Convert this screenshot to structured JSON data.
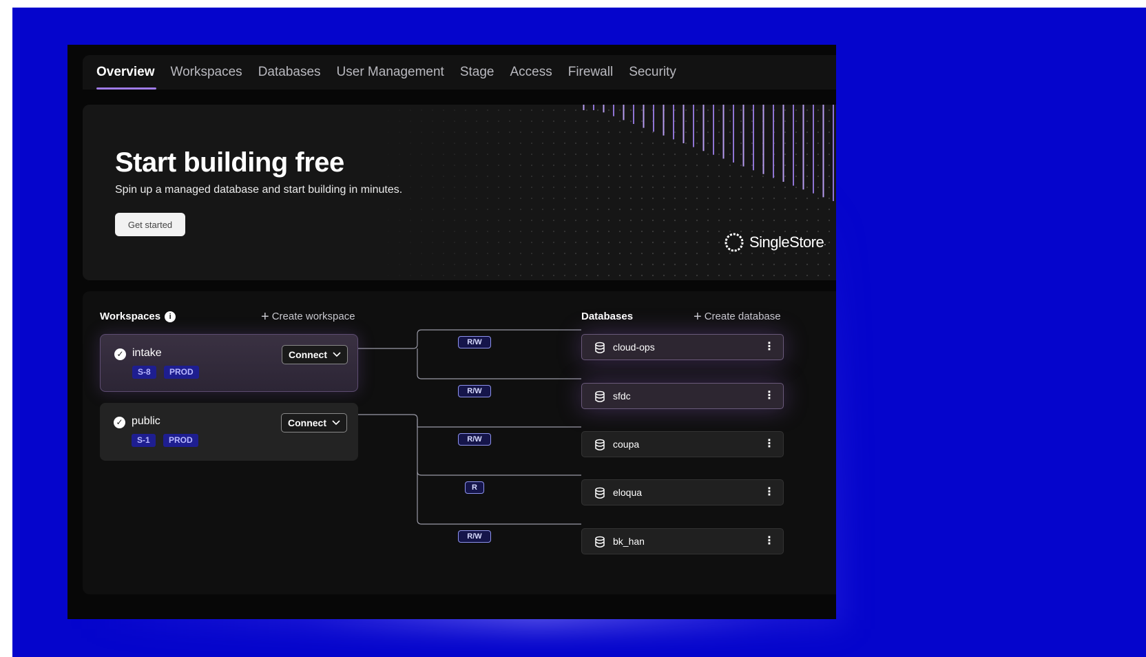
{
  "tabs": [
    {
      "label": "Overview",
      "active": true
    },
    {
      "label": "Workspaces"
    },
    {
      "label": "Databases"
    },
    {
      "label": "User Management"
    },
    {
      "label": "Stage"
    },
    {
      "label": "Access"
    },
    {
      "label": "Firewall"
    },
    {
      "label": "Security"
    }
  ],
  "hero": {
    "title": "Start building free",
    "subtitle": "Spin up a managed database and start building in minutes.",
    "cta_label": "Get started",
    "brand": "SingleStore",
    "brand_dot": "."
  },
  "workspaces": {
    "heading": "Workspaces",
    "info_icon": "i",
    "create_label": "Create workspace",
    "items": [
      {
        "name": "intake",
        "size": "S-8",
        "env": "PROD",
        "connect_label": "Connect",
        "selected": true
      },
      {
        "name": "public",
        "size": "S-1",
        "env": "PROD",
        "connect_label": "Connect",
        "selected": false
      }
    ]
  },
  "databases": {
    "heading": "Databases",
    "create_label": "Create database",
    "items": [
      {
        "name": "cloud-ops",
        "permission": "R/W",
        "highlight": true
      },
      {
        "name": "sfdc",
        "permission": "R/W",
        "highlight": true
      },
      {
        "name": "coupa",
        "permission": "R/W",
        "highlight": false
      },
      {
        "name": "eloqua",
        "permission": "R",
        "highlight": false
      },
      {
        "name": "bk_han",
        "permission": "R/W",
        "highlight": false
      }
    ]
  },
  "colors": {
    "backdrop": "#0505cc",
    "accent": "#a07ce8",
    "badge_bg": "#1e1e90",
    "permission_border": "#8f94f0"
  },
  "icons": {
    "check": "check-circle-icon",
    "chevron": "chevron-down-icon",
    "database": "database-icon",
    "kebab": "kebab-menu-icon",
    "plus": "plus-icon",
    "logo": "singlestore-logo-icon"
  }
}
